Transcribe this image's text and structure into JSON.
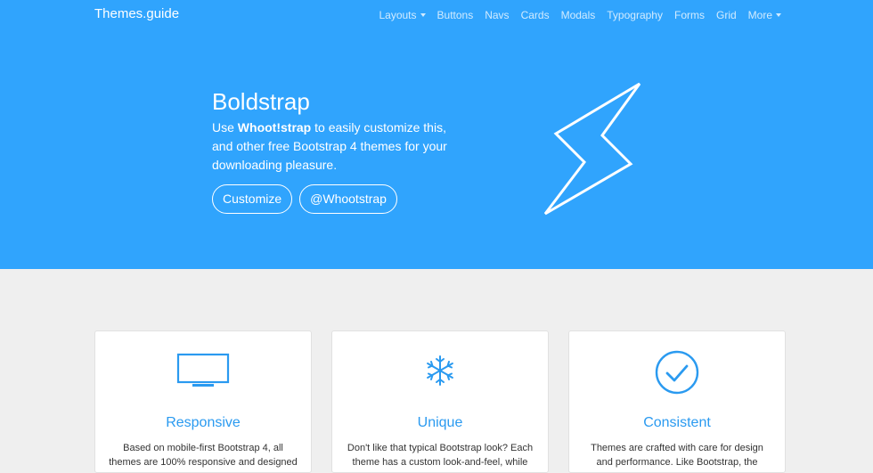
{
  "nav": {
    "brand": "Themes.guide",
    "items": [
      {
        "label": "Layouts",
        "dropdown": true
      },
      {
        "label": "Buttons"
      },
      {
        "label": "Navs"
      },
      {
        "label": "Cards"
      },
      {
        "label": "Modals"
      },
      {
        "label": "Typography"
      },
      {
        "label": "Forms"
      },
      {
        "label": "Grid"
      },
      {
        "label": "More",
        "dropdown": true
      }
    ]
  },
  "hero": {
    "title": "Boldstrap",
    "lead_prefix": "Use ",
    "lead_bold": "Whoot!strap",
    "lead_suffix": " to easily customize this, and other free Bootstrap 4 themes for your downloading pleasure.",
    "buttons": [
      "Customize",
      "@Whootstrap"
    ],
    "icon": "lightning-bolt-icon"
  },
  "features": [
    {
      "icon": "monitor-icon",
      "title": "Responsive",
      "text": "Based on mobile-first Bootstrap 4, all themes are 100% responsive and designed"
    },
    {
      "icon": "snowflake-icon",
      "title": "Unique",
      "text": "Don't like that typical Bootstrap look? Each theme has a custom look-and-feel, while"
    },
    {
      "icon": "check-circle-icon",
      "title": "Consistent",
      "text": "Themes are crafted with care for design and performance. Like Bootstrap, the"
    }
  ],
  "colors": {
    "primary": "#30a4fd",
    "accent": "#2a9af0",
    "background": "#efefef"
  }
}
